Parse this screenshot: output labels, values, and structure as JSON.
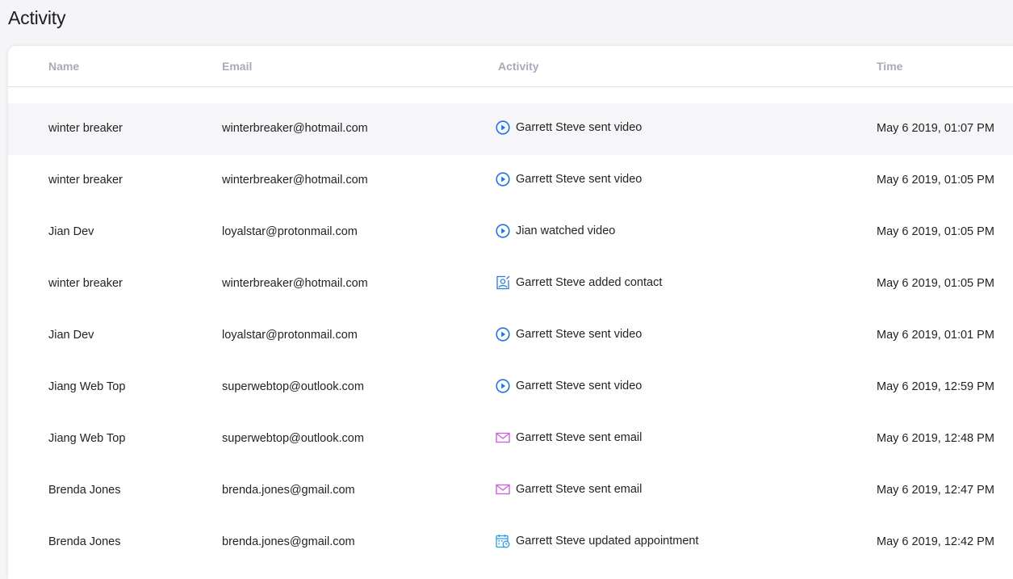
{
  "page": {
    "title": "Activity"
  },
  "columns": {
    "name": "Name",
    "email": "Email",
    "activity": "Activity",
    "time": "Time"
  },
  "colors": {
    "video": "#1a73e8",
    "contact": "#2b7bd6",
    "email": "#c964d9",
    "appointment": "#2b9be6"
  },
  "rows": [
    {
      "name": "winter breaker",
      "email": "winterbreaker@hotmail.com",
      "icon": "play-circle-icon",
      "activity": "Garrett Steve sent video",
      "time": "May 6 2019, 01:07 PM",
      "highlighted": true
    },
    {
      "name": "winter breaker",
      "email": "winterbreaker@hotmail.com",
      "icon": "play-circle-icon",
      "activity": "Garrett Steve sent video",
      "time": "May 6 2019, 01:05 PM"
    },
    {
      "name": "Jian Dev",
      "email": "loyalstar@protonmail.com",
      "icon": "play-circle-icon",
      "activity": "Jian watched video",
      "time": "May 6 2019, 01:05 PM"
    },
    {
      "name": "winter breaker",
      "email": "winterbreaker@hotmail.com",
      "icon": "contact-icon",
      "activity": "Garrett Steve added contact",
      "time": "May 6 2019, 01:05 PM"
    },
    {
      "name": "Jian Dev",
      "email": "loyalstar@protonmail.com",
      "icon": "play-circle-icon",
      "activity": "Garrett Steve sent video",
      "time": "May 6 2019, 01:01 PM"
    },
    {
      "name": "Jiang Web Top",
      "email": "superwebtop@outlook.com",
      "icon": "play-circle-icon",
      "activity": "Garrett Steve sent video",
      "time": "May 6 2019, 12:59 PM"
    },
    {
      "name": "Jiang Web Top",
      "email": "superwebtop@outlook.com",
      "icon": "envelope-icon",
      "activity": "Garrett Steve sent email",
      "time": "May 6 2019, 12:48 PM"
    },
    {
      "name": "Brenda Jones",
      "email": "brenda.jones@gmail.com",
      "icon": "envelope-icon",
      "activity": "Garrett Steve sent email",
      "time": "May 6 2019, 12:47 PM"
    },
    {
      "name": "Brenda Jones",
      "email": "brenda.jones@gmail.com",
      "icon": "calendar-icon",
      "activity": "Garrett Steve updated appointment",
      "time": "May 6 2019, 12:42 PM"
    }
  ]
}
